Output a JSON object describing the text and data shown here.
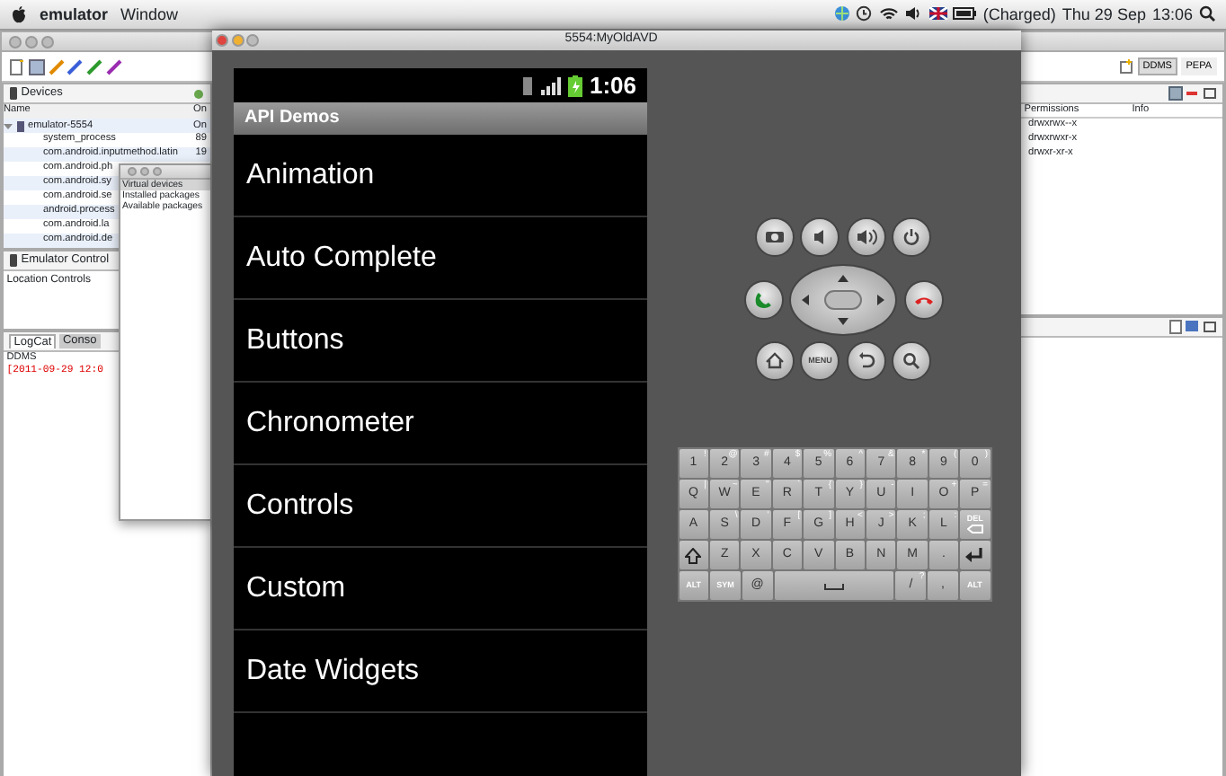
{
  "menubar": {
    "app": "emulator",
    "menus": [
      "Window"
    ],
    "battery_text": "(Charged)",
    "date": "Thu 29 Sep",
    "time": "13:06"
  },
  "eclipse": {
    "devices_tab": "Devices",
    "columns": [
      "Name",
      "On"
    ],
    "devices": [
      {
        "name": "emulator-5554",
        "status": "On",
        "expanded": true,
        "children": [
          {
            "name": "system_process",
            "pid": "89"
          },
          {
            "name": "com.android.inputmethod.latin",
            "pid": "19"
          },
          {
            "name": "com.android.ph"
          },
          {
            "name": "com.android.sy"
          },
          {
            "name": "com.android.se"
          },
          {
            "name": "android.process"
          },
          {
            "name": "com.android.la"
          },
          {
            "name": "com.android.de"
          }
        ]
      }
    ],
    "emulator_control_tab": "Emulator Control",
    "location_controls": "Location Controls",
    "log_tabs": [
      {
        "label": "LogCat",
        "selected": true
      },
      {
        "label": "Conso",
        "selected": false
      }
    ],
    "log_title": "DDMS",
    "log_lines": [
      "[2011-09-29 12:0"
    ],
    "perspectives": [
      {
        "label": "DDMS",
        "selected": true
      },
      {
        "label": "PEPA",
        "selected": false
      }
    ],
    "file_columns": [
      "Permissions",
      "Info"
    ],
    "file_rows": [
      "drwxrwx--x",
      "drwxrwxr-x",
      "drwxr-xr-x"
    ]
  },
  "sdk_window": {
    "items": [
      {
        "label": "Virtual devices",
        "selected": true
      },
      {
        "label": "Installed packages",
        "selected": false
      },
      {
        "label": "Available packages",
        "selected": false
      }
    ]
  },
  "emulator": {
    "title": "5554:MyOldAVD",
    "status_time": "1:06",
    "app_title": "API Demos",
    "list_items": [
      "Animation",
      "Auto Complete",
      "Buttons",
      "Chronometer",
      "Controls",
      "Custom",
      "Date Widgets"
    ],
    "hardware_buttons": [
      [
        {
          "kind": "camera"
        },
        {
          "kind": "volume_down"
        },
        {
          "kind": "volume_up"
        },
        {
          "kind": "power"
        }
      ],
      [
        {
          "kind": "call"
        },
        {
          "kind": "dpad"
        },
        {
          "kind": "end_call"
        }
      ],
      [
        {
          "kind": "home"
        },
        {
          "kind": "menu",
          "label": "MENU"
        },
        {
          "kind": "back"
        },
        {
          "kind": "search"
        }
      ]
    ],
    "keyboard": [
      [
        {
          "kind": "key",
          "label": "1",
          "alt": "!"
        },
        {
          "kind": "key",
          "label": "2",
          "alt": "@"
        },
        {
          "kind": "key",
          "label": "3",
          "alt": "#"
        },
        {
          "kind": "key",
          "label": "4",
          "alt": "$"
        },
        {
          "kind": "key",
          "label": "5",
          "alt": "%"
        },
        {
          "kind": "key",
          "label": "6",
          "alt": "^"
        },
        {
          "kind": "key",
          "label": "7",
          "alt": "&"
        },
        {
          "kind": "key",
          "label": "8",
          "alt": "*"
        },
        {
          "kind": "key",
          "label": "9",
          "alt": "("
        },
        {
          "kind": "key",
          "label": "0",
          "alt": ")"
        }
      ],
      [
        {
          "kind": "key",
          "label": "Q",
          "alt": "|"
        },
        {
          "kind": "key",
          "label": "W",
          "alt": "~"
        },
        {
          "kind": "key",
          "label": "E",
          "alt": "\""
        },
        {
          "kind": "key",
          "label": "R",
          "alt": "`"
        },
        {
          "kind": "key",
          "label": "T",
          "alt": "{"
        },
        {
          "kind": "key",
          "label": "Y",
          "alt": "}"
        },
        {
          "kind": "key",
          "label": "U",
          "alt": "-"
        },
        {
          "kind": "key",
          "label": "I"
        },
        {
          "kind": "key",
          "label": "O",
          "alt": "+"
        },
        {
          "kind": "key",
          "label": "P",
          "alt": "="
        }
      ],
      [
        {
          "kind": "key",
          "label": "A"
        },
        {
          "kind": "key",
          "label": "S",
          "alt": "\\"
        },
        {
          "kind": "key",
          "label": "D",
          "alt": "'"
        },
        {
          "kind": "key",
          "label": "F",
          "alt": "["
        },
        {
          "kind": "key",
          "label": "G",
          "alt": "]"
        },
        {
          "kind": "key",
          "label": "H",
          "alt": "<"
        },
        {
          "kind": "key",
          "label": "J",
          "alt": ">"
        },
        {
          "kind": "key",
          "label": "K",
          "alt": ";"
        },
        {
          "kind": "key",
          "label": "L",
          "alt": ":"
        },
        {
          "kind": "del",
          "label": "DEL"
        }
      ],
      [
        {
          "kind": "shift"
        },
        {
          "kind": "key",
          "label": "Z"
        },
        {
          "kind": "key",
          "label": "X"
        },
        {
          "kind": "key",
          "label": "C"
        },
        {
          "kind": "key",
          "label": "V"
        },
        {
          "kind": "key",
          "label": "B"
        },
        {
          "kind": "key",
          "label": "N"
        },
        {
          "kind": "key",
          "label": "M"
        },
        {
          "kind": "key",
          "label": "."
        },
        {
          "kind": "enter"
        }
      ],
      [
        {
          "kind": "key",
          "label": "ALT"
        },
        {
          "kind": "key",
          "label": "SYM"
        },
        {
          "kind": "key",
          "label": "@"
        },
        {
          "kind": "space"
        },
        {
          "kind": "key",
          "label": "/",
          "alt": "?"
        },
        {
          "kind": "key",
          "label": ","
        },
        {
          "kind": "key",
          "label": "ALT"
        }
      ]
    ]
  }
}
